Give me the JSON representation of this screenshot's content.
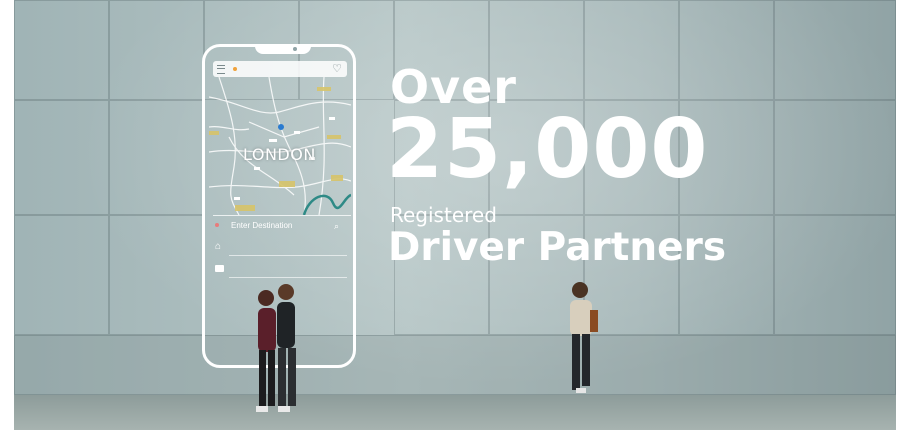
{
  "headline": {
    "line1": "Over",
    "number": "25,000",
    "line3": "Registered",
    "line4": "Driver Partners"
  },
  "phone": {
    "map_city_label": "LONDON",
    "destination_placeholder": "Enter Destination",
    "icons": [
      "menu-icon",
      "heart-icon",
      "search-icon",
      "home-icon",
      "briefcase-icon"
    ]
  },
  "colors": {
    "text": "#ffffff",
    "wall": "#a8b9ba",
    "accent_pin": "#f0a23b",
    "destination_dot": "#e87b7b"
  }
}
